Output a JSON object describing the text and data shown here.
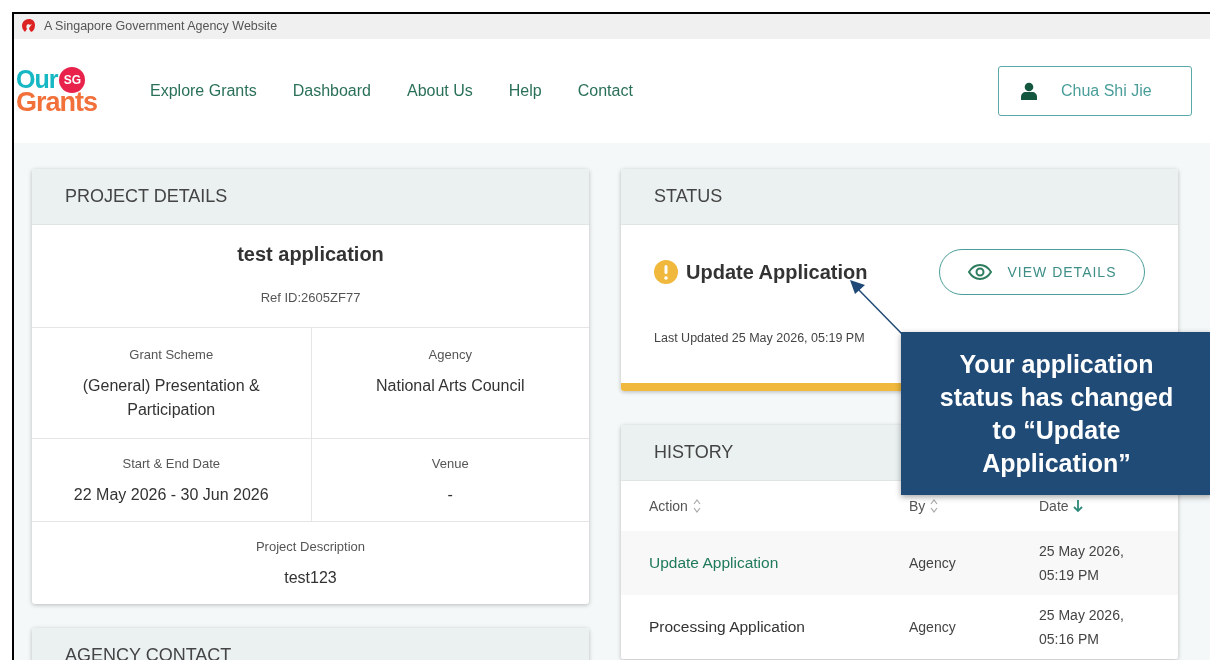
{
  "gov_bar": {
    "text": "A Singapore Government Agency Website"
  },
  "header": {
    "logo": {
      "top": "Our",
      "badge": "SG",
      "bottom": "Grants"
    },
    "nav": [
      {
        "label": "Explore Grants"
      },
      {
        "label": "Dashboard"
      },
      {
        "label": "About Us"
      },
      {
        "label": "Help"
      },
      {
        "label": "Contact"
      }
    ],
    "user_button": "Chua Shi Jie"
  },
  "project_details": {
    "title": "PROJECT DETAILS",
    "name": "test application",
    "ref": "Ref ID:2605ZF77",
    "fields": [
      {
        "label": "Grant Scheme",
        "value": "(General) Presentation & Participation"
      },
      {
        "label": "Agency",
        "value": "National Arts Council"
      },
      {
        "label": "Start & End Date",
        "value": "22 May 2026 - 30 Jun 2026"
      },
      {
        "label": "Venue",
        "value": "-"
      }
    ],
    "description": {
      "label": "Project Description",
      "value": "test123"
    }
  },
  "agency_contact": {
    "title": "AGENCY CONTACT"
  },
  "status": {
    "title": "STATUS",
    "kind": "warning",
    "state": "Update Application",
    "button": "VIEW DETAILS",
    "last_updated": "Last Updated 25 May 2026, 05:19 PM"
  },
  "history": {
    "title": "HISTORY",
    "columns": [
      {
        "label": "Action",
        "sorted": false
      },
      {
        "label": "By",
        "sorted": false
      },
      {
        "label": "Date",
        "sorted": true
      }
    ],
    "rows": [
      {
        "action": "Update Application",
        "by": "Agency",
        "date": "25 May 2026, 05:19 PM",
        "selected": true
      },
      {
        "action": "Processing Application",
        "by": "Agency",
        "date": "25 May 2026, 05:16 PM",
        "selected": false
      }
    ]
  },
  "callout": {
    "text": "Your application status has changed to “Update Application”"
  }
}
